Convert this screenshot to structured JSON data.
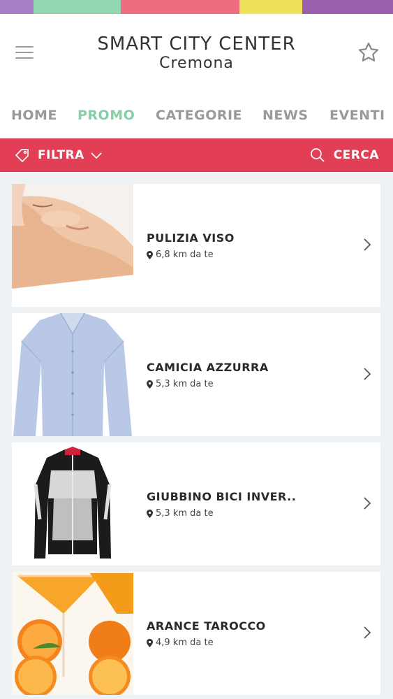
{
  "top_band_colors": [
    "#a77fc7",
    "#93d7b2",
    "#ee6e7f",
    "#eee15c",
    "#9b5fb0"
  ],
  "header": {
    "title": "SMART CITY CENTER",
    "city": "Cremona",
    "menu_icon": "hamburger-menu-icon",
    "favorite_icon": "star-icon"
  },
  "tabs": [
    {
      "label": "HOME",
      "active": false
    },
    {
      "label": "PROMO",
      "active": true
    },
    {
      "label": "CATEGORIE",
      "active": false
    },
    {
      "label": "NEWS",
      "active": false
    },
    {
      "label": "EVENTI",
      "active": false
    }
  ],
  "filterbar": {
    "filter_label": "FILTRA",
    "search_label": "CERCA",
    "background": "#e23e55"
  },
  "items": [
    {
      "title": "PULIZIA VISO",
      "distance": "6,8 km da te",
      "image": "face-treatment-photo"
    },
    {
      "title": "CAMICIA AZZURRA",
      "distance": "5,3 km da te",
      "image": "blue-shirt-photo"
    },
    {
      "title": "GIUBBINO BICI INVER..",
      "distance": "5,3 km da te",
      "image": "cycling-jacket-photo"
    },
    {
      "title": "ARANCE TAROCCO",
      "distance": "4,9 km da te",
      "image": "orange-juice-photo"
    }
  ],
  "colors": {
    "accent_tab": "#86cfa7",
    "inactive_tab": "#9a9a9a"
  }
}
